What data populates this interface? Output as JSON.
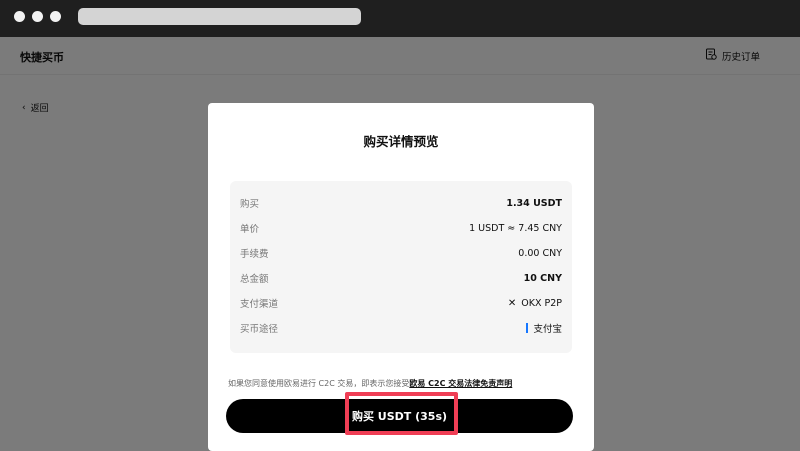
{
  "app": {
    "title": "快捷买币",
    "history_label": "历史订单",
    "back_label": "返回"
  },
  "card": {
    "title": "购买详情预览",
    "rows": [
      {
        "key": "购买",
        "value": "1.34 USDT"
      },
      {
        "key": "单价",
        "value": "1 USDT ≈ 7.45 CNY"
      },
      {
        "key": "手续费",
        "value": "0.00 CNY"
      },
      {
        "key": "总金额",
        "value": "10 CNY"
      },
      {
        "key": "支付渠道",
        "value": "OKX P2P"
      },
      {
        "key": "买币途径",
        "value": "支付宝"
      }
    ],
    "disclaimer_text": "如果您同意使用欧易进行 C2C 交易，即表示您接受",
    "disclaimer_link": "欧易 C2C 交易法律免责声明",
    "buy_button": "购买 USDT (35s)"
  },
  "colors": {
    "highlight": "#ef3e55",
    "alipay": "#1677ff",
    "button": "#000000"
  },
  "icons": {
    "history": "receipt-icon",
    "back": "chevron-left-icon",
    "channel": "okx-logo-icon",
    "method": "alipay-icon"
  }
}
